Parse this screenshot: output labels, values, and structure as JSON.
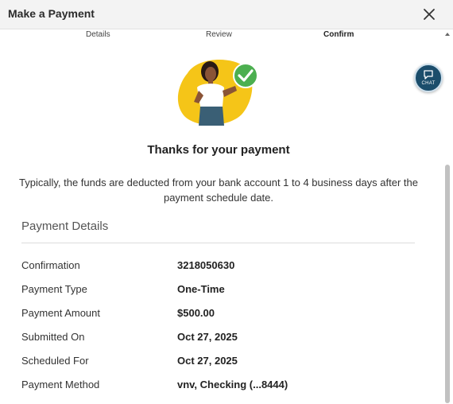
{
  "header": {
    "title": "Make a Payment",
    "close_icon": "close-icon"
  },
  "steps": [
    {
      "label": "Details"
    },
    {
      "label": "Review"
    },
    {
      "label": "Confirm",
      "active": true
    }
  ],
  "chat": {
    "label": "CHAT",
    "icon": "chat-bubble-icon"
  },
  "illustration": {
    "icon": "success-check-icon"
  },
  "thanks": "Thanks for your payment",
  "info": "Typically, the funds are deducted from your bank account 1 to 4 business days after the payment schedule date.",
  "details": {
    "heading": "Payment Details",
    "rows": [
      {
        "label": "Confirmation",
        "value": "3218050630"
      },
      {
        "label": "Payment Type",
        "value": "One-Time"
      },
      {
        "label": "Payment Amount",
        "value": "$500.00"
      },
      {
        "label": "Submitted On",
        "value": "Oct 27, 2025"
      },
      {
        "label": "Scheduled For",
        "value": "Oct 27, 2025"
      },
      {
        "label": "Payment Method",
        "value": "vnv, Checking (...8444)"
      }
    ]
  },
  "colors": {
    "accent_green": "#4caf50",
    "illustration_yellow": "#f5c518",
    "chat_blue": "#1b4d6b"
  }
}
